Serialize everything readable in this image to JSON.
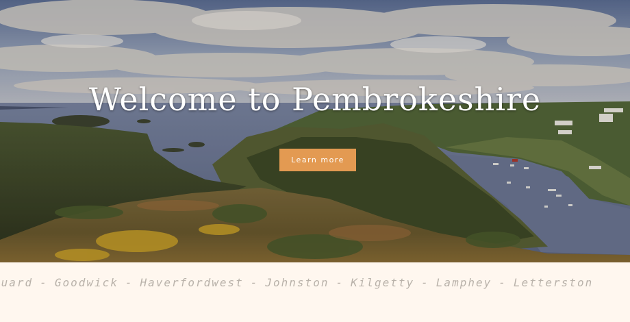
{
  "hero": {
    "title": "Welcome to Pembrokeshire",
    "button_label": "Learn more",
    "button_color": "#e39a52"
  },
  "ticker": {
    "separator": "-",
    "items": [
      "guard",
      "Goodwick",
      "Haverfordwest",
      "Johnston",
      "Kilgetty",
      "Lamphey",
      "Letterston"
    ]
  },
  "colors": {
    "background": "#fff7ef",
    "ticker_text": "#b9b2aa"
  }
}
